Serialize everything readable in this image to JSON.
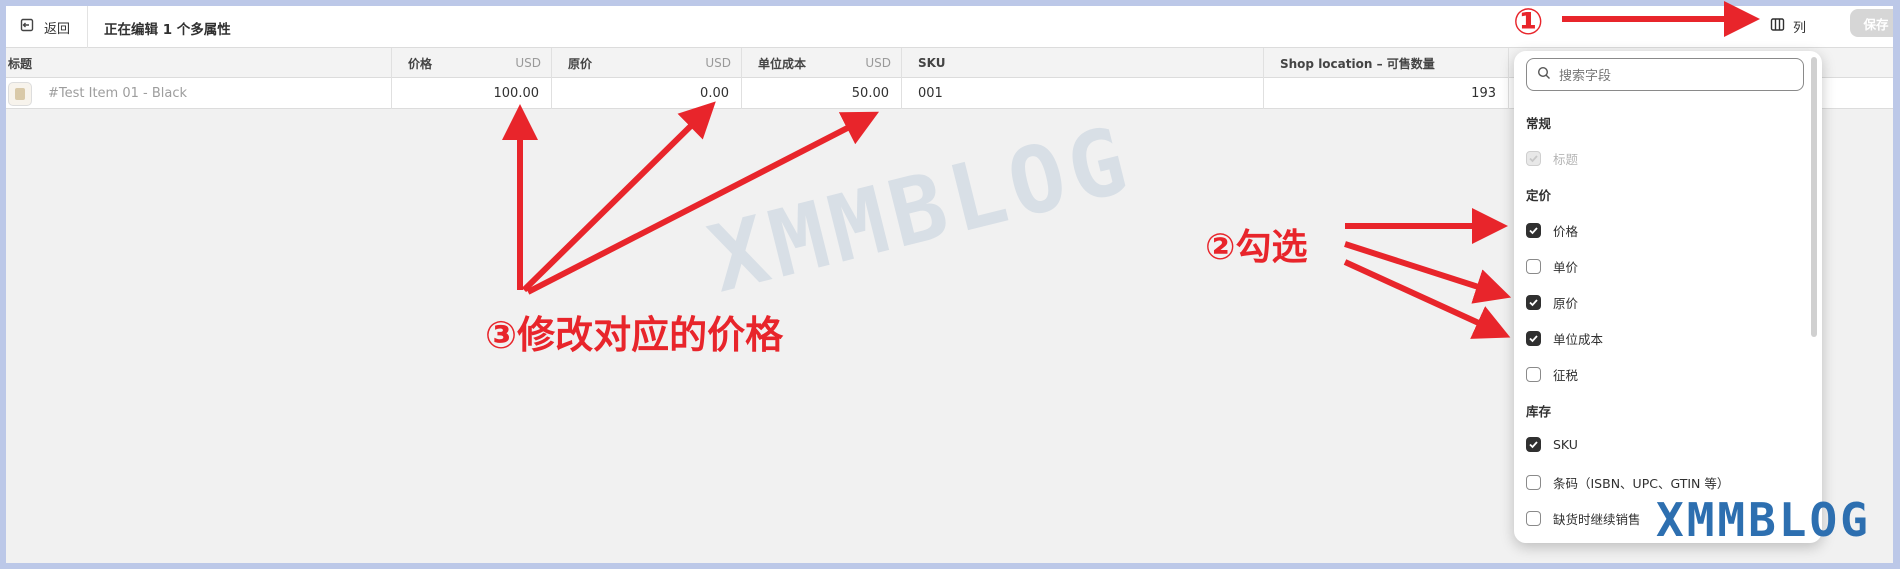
{
  "topbar": {
    "back_label": "返回",
    "title": "正在编辑 1 个多属性",
    "columns_label": "列",
    "save_label": "保存"
  },
  "table": {
    "headers": [
      {
        "label": "标题",
        "currency": ""
      },
      {
        "label": "价格",
        "currency": "USD"
      },
      {
        "label": "原价",
        "currency": "USD"
      },
      {
        "label": "单位成本",
        "currency": "USD"
      },
      {
        "label": "SKU",
        "currency": ""
      },
      {
        "label": "Shop location – 可售数量",
        "currency": ""
      }
    ],
    "rows": [
      {
        "title": "#Test Item 01 - Black",
        "price": "100.00",
        "compare_price": "0.00",
        "cost": "50.00",
        "sku": "001",
        "available": "193"
      }
    ]
  },
  "columns_panel": {
    "search_placeholder": "搜索字段",
    "sections": [
      {
        "title": "常规",
        "options": [
          {
            "label": "标题",
            "checked": true,
            "disabled": true
          }
        ]
      },
      {
        "title": "定价",
        "options": [
          {
            "label": "价格",
            "checked": true
          },
          {
            "label": "单价",
            "checked": false
          },
          {
            "label": "原价",
            "checked": true
          },
          {
            "label": "单位成本",
            "checked": true
          },
          {
            "label": "征税",
            "checked": false
          }
        ]
      },
      {
        "title": "库存",
        "options": [
          {
            "label": "SKU",
            "checked": true
          },
          {
            "label": "条码（ISBN、UPC、GTIN 等）",
            "checked": false
          },
          {
            "label": "缺货时继续销售",
            "checked": false
          }
        ]
      }
    ]
  },
  "annotations": {
    "step1": "①",
    "step2": "②勾选",
    "step3": "③修改对应的价格",
    "color": "#e8252b"
  },
  "watermark": {
    "text": "XMMBLOG",
    "corner_text": "XMMBLOG"
  }
}
